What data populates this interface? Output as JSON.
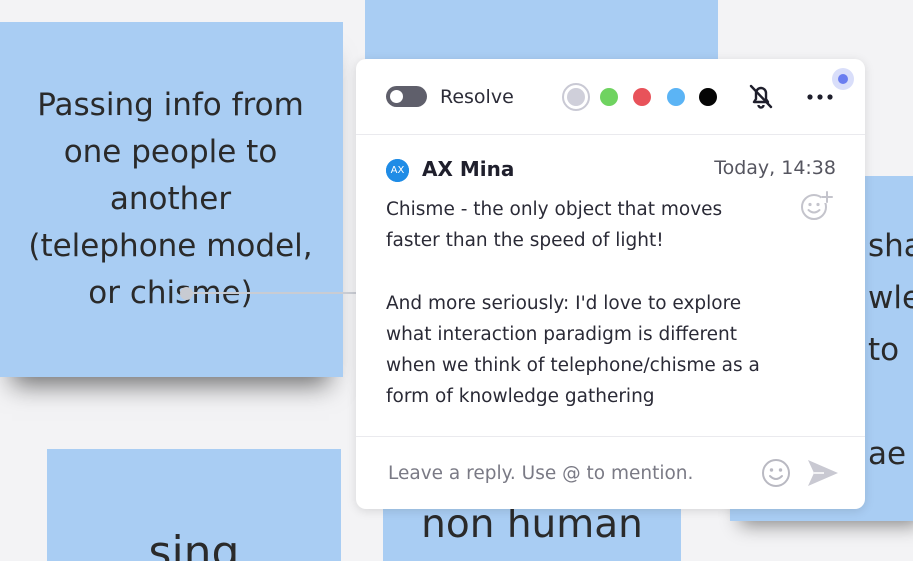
{
  "board": {
    "stickies": {
      "left": [
        "Passing info from",
        "one people to",
        "another",
        "(telephone model,",
        "or chisme)"
      ],
      "right": [
        "sha",
        "wle",
        "to",
        "",
        "ae"
      ],
      "bottom_left": "sing",
      "bottom_center": "non human"
    }
  },
  "panel": {
    "resolve_label": "Resolve",
    "colors": [
      "#cfcfda",
      "#6fd360",
      "#e8525a",
      "#5bb4f5",
      "#050505"
    ],
    "icons": {
      "mute": "bell-off-icon",
      "more": "more-horizontal-icon",
      "add_reaction": "add-reaction-icon",
      "emoji": "emoji-icon",
      "send": "send-icon"
    },
    "comment": {
      "avatar_initials": "AX",
      "author": "AX Mina",
      "timestamp": "Today, 14:38",
      "body": [
        "Chisme - the only object that moves",
        "faster than the speed of light!",
        "",
        "And more seriously: I'd love to explore",
        "what interaction paradigm is different",
        "when we think of telephone/chisme as a",
        "form of knowledge gathering"
      ]
    },
    "reply": {
      "placeholder": "Leave a reply. Use @ to mention.",
      "value": ""
    }
  }
}
